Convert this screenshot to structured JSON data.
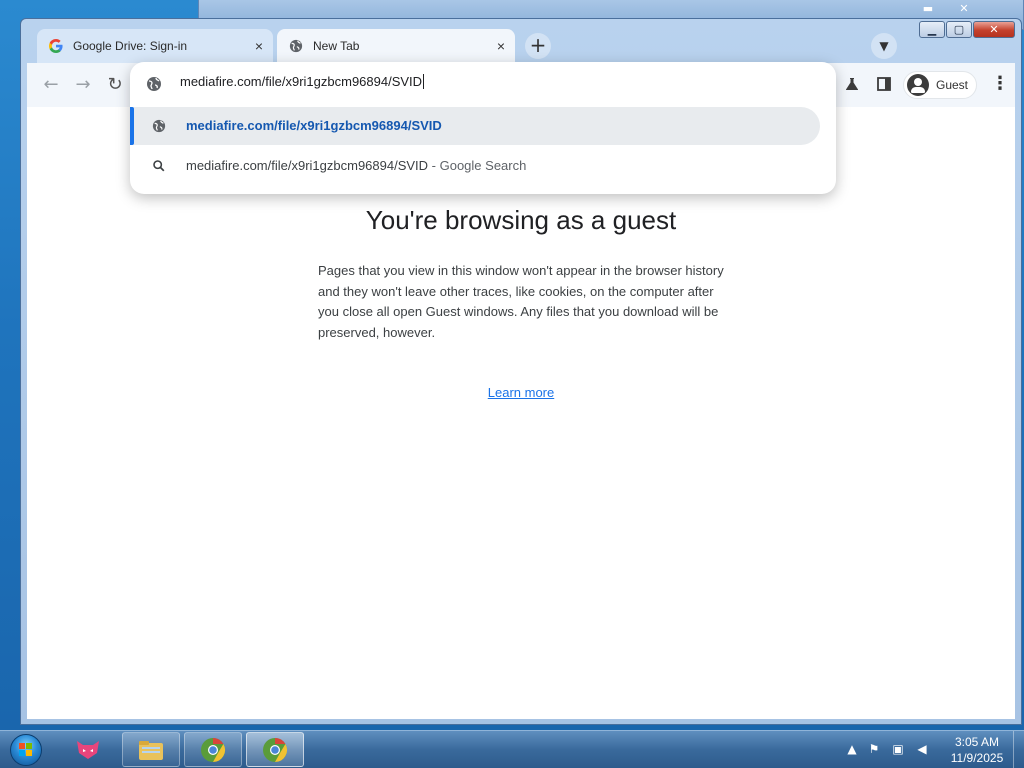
{
  "browser": {
    "tabs": [
      {
        "label": "Google Drive: Sign-in",
        "icon": "google-icon",
        "close": "×"
      },
      {
        "label": "New Tab",
        "icon": "globe-icon",
        "close": "×"
      }
    ],
    "new_tab_symbol": "+",
    "profile_label": "Guest"
  },
  "omnibox": {
    "value": "mediafire.com/file/x9ri1gzbcm96894/SVID",
    "suggestions": [
      {
        "text": "mediafire.com/file/x9ri1gzbcm96894/SVID",
        "suffix": ""
      },
      {
        "text": "mediafire.com/file/x9ri1gzbcm96894/SVID",
        "suffix": " - Google Search"
      }
    ]
  },
  "page": {
    "title": "You're browsing as a guest",
    "description": "Pages that you view in this window won't appear in the browser history and they won't leave other traces, like cookies, on the computer after you close all open Guest windows. Any files that you download will be preserved, however.",
    "learn_more": "Learn more"
  },
  "taskbar": {
    "time": "3:05 AM",
    "date": "11/9/2025"
  },
  "colors": {
    "accent": "#1a73e8",
    "selected_suggestion_text": "#1558b0",
    "taskbar": "#3a6a9c"
  }
}
